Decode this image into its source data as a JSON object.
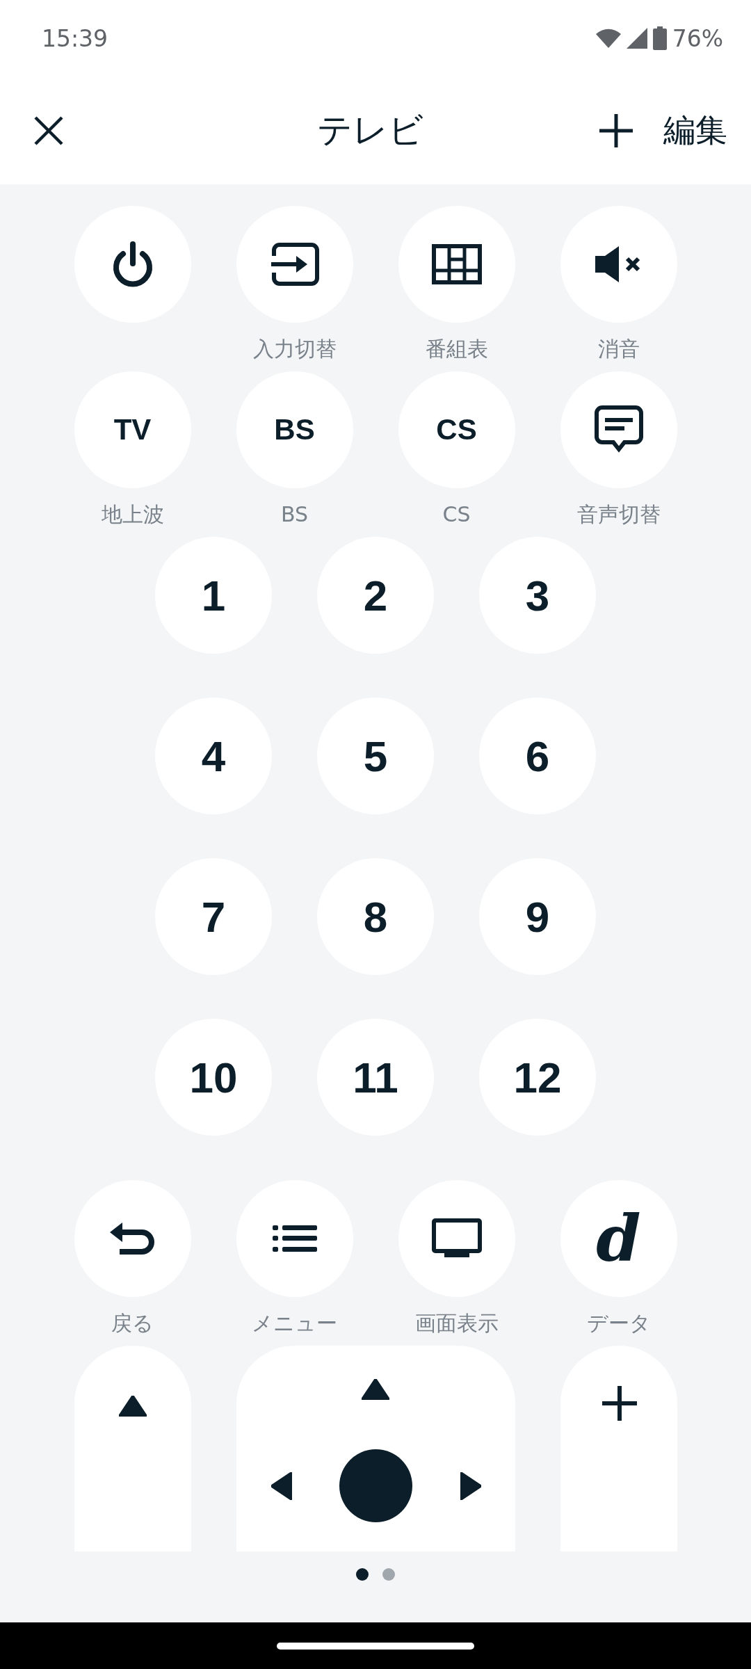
{
  "status_bar": {
    "time": "15:39",
    "battery": "76%"
  },
  "header": {
    "title": "テレビ",
    "edit_label": "編集"
  },
  "top_buttons": [
    {
      "kind": "power"
    },
    {
      "kind": "input",
      "label": "入力切替"
    },
    {
      "kind": "guide",
      "label": "番組表"
    },
    {
      "kind": "mute",
      "label": "消音"
    },
    {
      "kind": "text",
      "text": "TV",
      "label": "地上波"
    },
    {
      "kind": "text",
      "text": "BS",
      "label": "BS"
    },
    {
      "kind": "text",
      "text": "CS",
      "label": "CS"
    },
    {
      "kind": "caption",
      "label": "音声切替"
    }
  ],
  "numbers": [
    "1",
    "2",
    "3",
    "4",
    "5",
    "6",
    "7",
    "8",
    "9",
    "10",
    "11",
    "12"
  ],
  "bottom_buttons": [
    {
      "kind": "back",
      "label": "戻る"
    },
    {
      "kind": "menu",
      "label": "メニュー"
    },
    {
      "kind": "screen",
      "label": "画面表示"
    },
    {
      "kind": "letter",
      "text": "d",
      "label": "データ"
    }
  ],
  "pager": [
    {
      "selected": true
    },
    {
      "selected": false
    }
  ]
}
